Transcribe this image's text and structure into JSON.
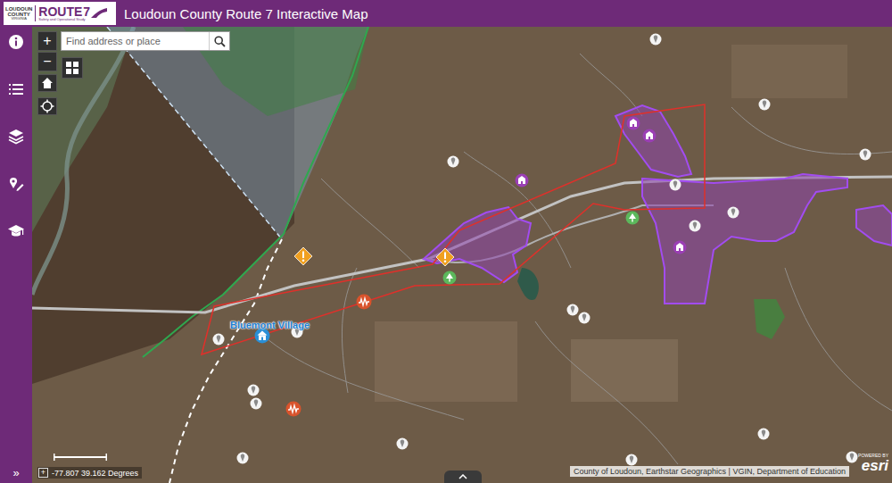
{
  "header": {
    "logo": {
      "county": "LOUDOUN",
      "county_sub": "COUNTY",
      "state": "VIRGINIA",
      "route": "ROUTE",
      "route_number": "7",
      "subtitle": "Safety and Operational Study"
    },
    "title": "Loudoun County Route 7 Interactive Map"
  },
  "sidebar": {
    "items": [
      {
        "kind": "info",
        "selected": false
      },
      {
        "kind": "legend",
        "selected": false
      },
      {
        "kind": "layers",
        "selected": false
      },
      {
        "kind": "draw",
        "selected": false
      },
      {
        "kind": "education",
        "selected": false
      }
    ],
    "expand": "»"
  },
  "controls": {
    "zoom_in": "+",
    "zoom_out": "−",
    "coord_toggle": "+"
  },
  "search": {
    "placeholder": "Find address or place"
  },
  "map": {
    "labels": [
      {
        "text": "Bluemont Village"
      }
    ],
    "markers": [
      {
        "kind": "landmark"
      },
      {
        "kind": "landmark"
      },
      {
        "kind": "landmark"
      },
      {
        "kind": "landmark"
      },
      {
        "kind": "landmark"
      },
      {
        "kind": "landmark"
      },
      {
        "kind": "landmark"
      },
      {
        "kind": "landmark"
      },
      {
        "kind": "landmark"
      },
      {
        "kind": "landmark"
      },
      {
        "kind": "landmark"
      },
      {
        "kind": "landmark"
      },
      {
        "kind": "landmark"
      },
      {
        "kind": "landmark"
      },
      {
        "kind": "landmark"
      },
      {
        "kind": "landmark"
      },
      {
        "kind": "landmark"
      },
      {
        "kind": "landmark"
      },
      {
        "kind": "school"
      },
      {
        "kind": "school"
      },
      {
        "kind": "school"
      },
      {
        "kind": "school"
      },
      {
        "kind": "hazard"
      },
      {
        "kind": "hazard"
      },
      {
        "kind": "park"
      },
      {
        "kind": "park"
      },
      {
        "kind": "crash"
      },
      {
        "kind": "crash"
      },
      {
        "kind": "home"
      }
    ]
  },
  "status": {
    "coordinates": "-77.807 39.162 Degrees"
  },
  "attribution": "County of Loudoun, Earthstar Geographics | VGIN, Department of Education",
  "powered_by": {
    "label": "POWERED BY",
    "brand": "esri"
  }
}
